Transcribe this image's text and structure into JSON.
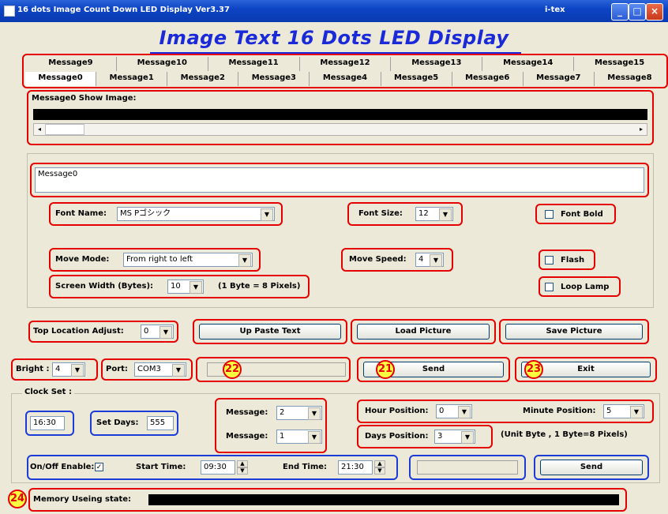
{
  "titlebar": {
    "title": "16 dots Image Count Down LED Display Ver3.37",
    "company": "i-tex"
  },
  "banner": "Image Text 16 Dots LED Display",
  "tabs_row1": [
    "Message9",
    "Message10",
    "Message11",
    "Message12",
    "Message13",
    "Message14",
    "Message15"
  ],
  "tabs_row2": [
    "Message0",
    "Message1",
    "Message2",
    "Message3",
    "Message4",
    "Message5",
    "Message6",
    "Message7",
    "Message8"
  ],
  "show_image_label": "Message0 Show Image:",
  "message_text": "Message0",
  "font": {
    "name_label": "Font Name:",
    "name_value": "MS Pゴシック",
    "size_label": "Font Size:",
    "size_value": "12",
    "bold_label": "Font Bold"
  },
  "move": {
    "mode_label": "Move Mode:",
    "mode_value": "From right to left",
    "speed_label": "Move Speed:",
    "speed_value": "4",
    "flash_label": "Flash"
  },
  "screen": {
    "width_label": "Screen Width (Bytes):",
    "width_value": "10",
    "note": "(1 Byte = 8 Pixels)",
    "loop_label": "Loop Lamp"
  },
  "top_adjust": {
    "label": "Top Location Adjust:",
    "value": "0"
  },
  "buttons": {
    "paste": "Up Paste Text",
    "load": "Load Picture",
    "save": "Save Picture",
    "send": "Send",
    "exit": "Exit",
    "send2": "Send"
  },
  "bright": {
    "label": "Bright :",
    "value": "4"
  },
  "port": {
    "label": "Port:",
    "value": "COM3"
  },
  "markers": {
    "m21": "21",
    "m22": "22",
    "m23": "23",
    "m24": "24"
  },
  "clock": {
    "section_label": "Clock Set :",
    "time": "16:30",
    "set_days_label": "Set Days:",
    "set_days_value": "555",
    "message1_label": "Message:",
    "message1_value": "2",
    "message2_label": "Message:",
    "message2_value": "1",
    "hour_label": "Hour Position:",
    "hour_value": "0",
    "minute_label": "Minute Position:",
    "minute_value": "5",
    "days_label": "Days Position:",
    "days_value": "3",
    "unit_note": "(Unit Byte , 1 Byte=8 Pixels)"
  },
  "schedule": {
    "enable_label": "On/Off Enable:",
    "start_label": "Start Time:",
    "start_value": "09:30",
    "end_label": "End Time:",
    "end_value": "21:30"
  },
  "memory": {
    "label": "Memory Useing state:"
  }
}
